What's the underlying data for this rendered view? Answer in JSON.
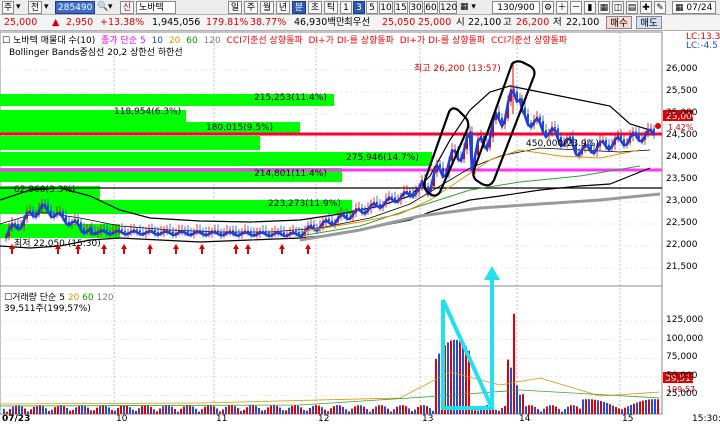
{
  "toolbar": {
    "items": [
      "주",
      "전",
      "285490",
      "신",
      "노바텍",
      "일",
      "주",
      "월",
      "년",
      "분",
      "초",
      "틱",
      "1",
      "3",
      "5",
      "10",
      "15",
      "30",
      "60",
      "120",
      "130/900",
      "07/24"
    ],
    "field_count": "130/900",
    "date": "07/24",
    "code": "285490",
    "name": "노바텍"
  },
  "quote": {
    "price": "25,000",
    "change": "2,950",
    "change_pct": "+13.38%",
    "volume": "1,945,056",
    "vol_ratio": "179.81%",
    "turnover": "38.77%",
    "amount": "46,930백만",
    "best_label": "최우선",
    "best_ask": "25,050",
    "best_bid": "25,000",
    "open_label": "시",
    "open": "22,100",
    "high_label": "고",
    "high": "26,200",
    "low_label": "저",
    "low": "22,100",
    "buy_button": "매수",
    "sell_button": "매도"
  },
  "legend": {
    "price_title": "노바텍 매물대 수(10)",
    "ma_label": "종가 단순 5",
    "ma_periods": [
      "10",
      "20",
      "60",
      "120"
    ],
    "cci1": "CCI기준선 상향돌파",
    "di1": "DI+가 DI-를 상향돌파",
    "di2": "DI+가 DI-를 상향돌파",
    "cci2": "CCI기준선 상향돌파",
    "bb": "Bollinger Bands중심선 20,2",
    "bb_upper": "상한선",
    "bb_lower": "하한선",
    "vol_title": "거래량 단순 5",
    "vol_periods": [
      "20",
      "60",
      "120"
    ],
    "vol_value": "39,511주(199,57%)",
    "lc_label": "LC:13.3",
    "lc_label2": "LC:-4.5"
  },
  "annotations": {
    "high_note": "최고 26,200 (13:57)",
    "low_note": "최저 22,050 (15:30)",
    "current_price_tag": "25,000",
    "current_pct_tag": "1.42%",
    "volume_tag": "39,511",
    "volume_tag2": "199.57"
  },
  "volume_profile": [
    {
      "label": "118,954(6.3%)"
    },
    {
      "label": "215,253(11.4%)"
    },
    {
      "label": "180,015(9.5%)"
    },
    {
      "label": "275,946(14.7%)"
    },
    {
      "label": "214,801(11.4%)"
    },
    {
      "label": "223,273(11.9%)"
    },
    {
      "label": "62,960(3.3%)"
    },
    {
      "label": "450,000(23.9%)"
    }
  ],
  "y_axis": {
    "price_ticks": [
      "26,000",
      "25,500",
      "25,000",
      "24,500",
      "24,000",
      "23,500",
      "23,000",
      "22,500",
      "22,000",
      "21,500"
    ],
    "volume_ticks": [
      "125,000",
      "100,000",
      "75,000",
      "50,000",
      "25,000"
    ],
    "corner_time": "15:30:0"
  },
  "x_axis": {
    "labels": [
      "07/23",
      "10",
      "11",
      "12",
      "13",
      "14",
      "15"
    ]
  },
  "colors": {
    "profile_green": "#00ff00",
    "support_red": "#ff0033",
    "support_magenta": "#ff33ff",
    "bollinger": "#000000",
    "ma5": "#1f3fd6",
    "candle_up": "#e00000",
    "candle_down": "#1f4fd6",
    "arrow_cyan": "#22e0ee"
  }
}
